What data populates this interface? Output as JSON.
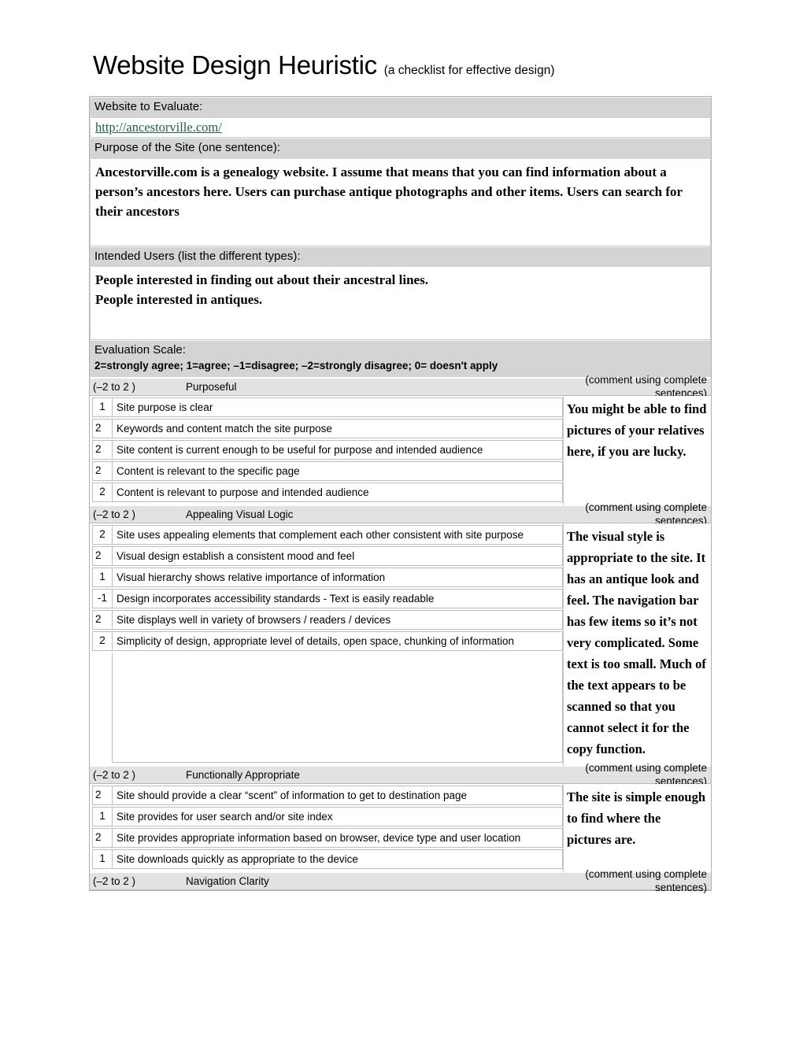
{
  "title": {
    "main": "Website Design Heuristic ",
    "sub": "(a checklist for effective design)"
  },
  "form": {
    "website_label": "Website to Evaluate:",
    "website_url": "http://ancestorville.com/",
    "purpose_label": "Purpose of the Site (one sentence):",
    "purpose_text": " Ancestorville.com is a genealogy website.  I assume that means that you can find information about a person’s ancestors here.  Users can purchase antique photographs and other items.  Users can search for their ancestors",
    "users_label": "Intended Users (list the different types):",
    "users_line1": "People interested in finding out about their ancestral lines.",
    "users_line2": "People interested in antiques.",
    "scale_label": "Evaluation Scale:",
    "scale_text": "2=strongly agree; 1=agree; –1=disagree; –2=strongly disagree; 0= doesn't apply"
  },
  "common": {
    "range": "(–2 to 2 )",
    "comment_hint": "(comment using complete sentences)"
  },
  "sections": [
    {
      "name": "Purposeful",
      "comment": "  You might be able to find pictures of your relatives here, if you are lucky.",
      "rows": [
        {
          "score": "1",
          "align": "center",
          "text": "Site purpose is clear"
        },
        {
          "score": "2",
          "align": "left",
          "text": "Keywords and content match the site purpose"
        },
        {
          "score": "2",
          "align": "left",
          "text": "Site content is current enough to be useful for purpose and intended audience"
        },
        {
          "score": "2",
          "align": "left",
          "text": "Content is relevant to the specific page"
        },
        {
          "score": "2",
          "align": "center",
          "text": "Content is relevant to purpose and intended audience"
        }
      ]
    },
    {
      "name": "Appealing Visual Logic",
      "comment": "  The visual style is appropriate to the site.  It has an antique look and feel.  The navigation bar has few items so it’s not very complicated.  Some text is too small.  Much of the text appears to be scanned so that you cannot select it for the copy function.",
      "rows": [
        {
          "score": "2",
          "align": "center",
          "text": "Site uses appealing elements that complement each other consistent with site purpose"
        },
        {
          "score": "2",
          "align": "left",
          "text": "Visual design establish a consistent mood and feel"
        },
        {
          "score": "1",
          "align": "center",
          "text": "Visual hierarchy shows relative importance of information"
        },
        {
          "score": "-1",
          "align": "center",
          "text": "Design incorporates accessibility standards - Text is easily readable"
        },
        {
          "score": "2",
          "align": "left",
          "text": "Site displays well in variety of browsers / readers / devices"
        },
        {
          "score": "2",
          "align": "center",
          "text": "Simplicity of design, appropriate level of details, open space, chunking of information"
        }
      ]
    },
    {
      "name": "Functionally Appropriate",
      "comment": "  The site is simple enough to find where the pictures are.",
      "rows": [
        {
          "score": "2",
          "align": "left",
          "text": "Site should provide a clear “scent” of information to get to destination page"
        },
        {
          "score": "1",
          "align": "center",
          "text": "Site provides for user search and/or site index"
        },
        {
          "score": "2",
          "align": "left",
          "text": "Site provides appropriate information based on browser, device type and user location"
        },
        {
          "score": "1",
          "align": "center",
          "text": "Site downloads quickly as appropriate to the device"
        }
      ]
    },
    {
      "name": "Navigation Clarity",
      "comment": null,
      "rows": []
    }
  ]
}
